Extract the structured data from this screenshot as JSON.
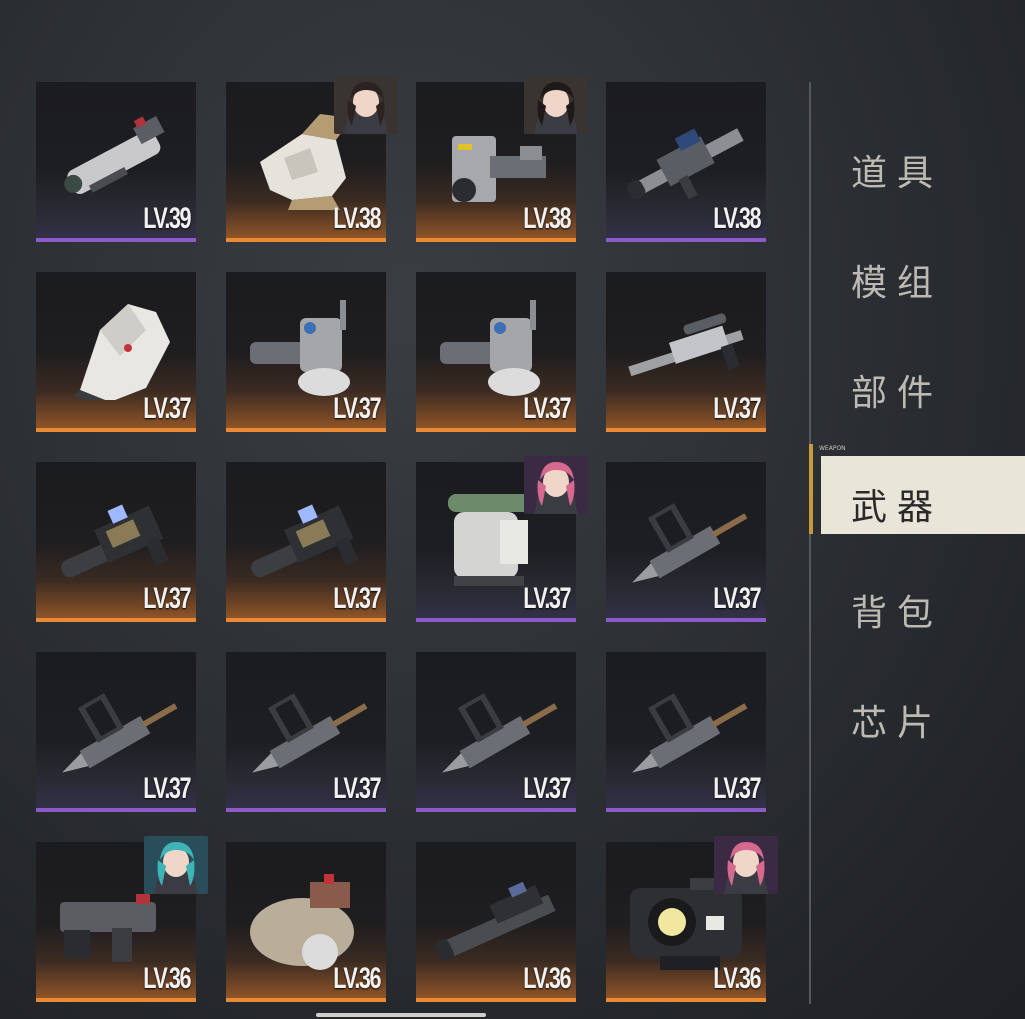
{
  "menu": {
    "items": [
      {
        "label": "道具"
      },
      {
        "label": "模组"
      },
      {
        "label": "部件"
      },
      {
        "label": "武器",
        "active": true,
        "tag": "WEAPON"
      },
      {
        "label": "背包"
      },
      {
        "label": "芯片"
      }
    ]
  },
  "rarity_colors": {
    "purple": "#8d5ac9",
    "orange": "#ea8a34"
  },
  "tiles": [
    {
      "level": "LV.39",
      "rarity": "purple",
      "icon": "gatling-cannon-icon",
      "portrait": null
    },
    {
      "level": "LV.38",
      "rarity": "orange",
      "icon": "gauntlet-icon",
      "portrait": "male-dark-hair-portrait"
    },
    {
      "level": "LV.38",
      "rarity": "orange",
      "icon": "heavy-cannon-icon",
      "portrait": "female-dark-hair-portrait"
    },
    {
      "level": "LV.38",
      "rarity": "purple",
      "icon": "rifle-scope-icon",
      "portrait": null
    },
    {
      "level": "LV.37",
      "rarity": "orange",
      "icon": "shield-drone-icon",
      "portrait": null
    },
    {
      "level": "LV.37",
      "rarity": "orange",
      "icon": "minigun-icon",
      "portrait": null
    },
    {
      "level": "LV.37",
      "rarity": "orange",
      "icon": "minigun-icon",
      "portrait": null
    },
    {
      "level": "LV.37",
      "rarity": "orange",
      "icon": "sniper-rifle-icon",
      "portrait": null
    },
    {
      "level": "LV.37",
      "rarity": "orange",
      "icon": "smg-icon",
      "portrait": null
    },
    {
      "level": "LV.37",
      "rarity": "orange",
      "icon": "smg-icon",
      "portrait": null
    },
    {
      "level": "LV.37",
      "rarity": "purple",
      "icon": "power-fist-icon",
      "portrait": "female-pink-hair-portrait"
    },
    {
      "level": "LV.37",
      "rarity": "purple",
      "icon": "drill-lance-icon",
      "portrait": null
    },
    {
      "level": "LV.37",
      "rarity": "purple",
      "icon": "drill-lance-icon",
      "portrait": null
    },
    {
      "level": "LV.37",
      "rarity": "purple",
      "icon": "drill-lance-icon",
      "portrait": null
    },
    {
      "level": "LV.37",
      "rarity": "purple",
      "icon": "drill-lance-icon",
      "portrait": null
    },
    {
      "level": "LV.37",
      "rarity": "purple",
      "icon": "drill-lance-icon",
      "portrait": null
    },
    {
      "level": "LV.36",
      "rarity": "orange",
      "icon": "pistol-icon",
      "portrait": "female-teal-hair-portrait"
    },
    {
      "level": "LV.36",
      "rarity": "orange",
      "icon": "hover-cannon-icon",
      "portrait": null
    },
    {
      "level": "LV.36",
      "rarity": "orange",
      "icon": "assault-rifle-icon",
      "portrait": null
    },
    {
      "level": "LV.36",
      "rarity": "orange",
      "icon": "camera-turret-icon",
      "portrait": "female-pink-hair-portrait"
    }
  ]
}
